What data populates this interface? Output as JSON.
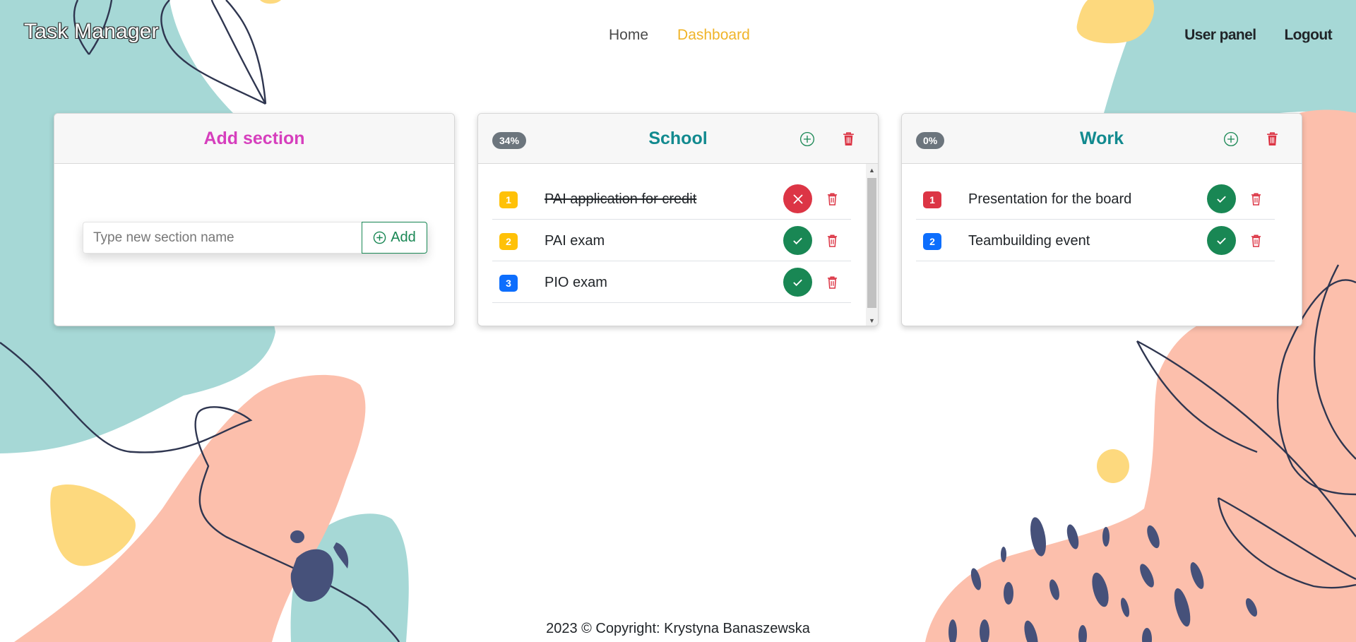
{
  "app": {
    "brand": "Task Manager"
  },
  "nav": {
    "links": [
      {
        "label": "Home",
        "active": false
      },
      {
        "label": "Dashboard",
        "active": true
      }
    ],
    "right": [
      "User panel",
      "Logout"
    ]
  },
  "add_section": {
    "title": "Add section",
    "input_placeholder": "Type new section name",
    "input_value": "",
    "button_label": "Add"
  },
  "sections": [
    {
      "title": "School",
      "progress": "34%",
      "tasks": [
        {
          "num": "1",
          "text": "PAI application for credit",
          "done": true,
          "badge_color": "#ffc107",
          "status": "undo",
          "status_icon": "x-icon"
        },
        {
          "num": "2",
          "text": "PAI exam",
          "done": false,
          "badge_color": "#ffc107",
          "status": "complete",
          "status_icon": "check-icon"
        },
        {
          "num": "3",
          "text": "PIO exam",
          "done": false,
          "badge_color": "#0d6efd",
          "status": "complete",
          "status_icon": "check-icon"
        }
      ]
    },
    {
      "title": "Work",
      "progress": "0%",
      "tasks": [
        {
          "num": "1",
          "text": "Presentation for the board",
          "done": false,
          "badge_color": "#dc3545",
          "status": "complete",
          "status_icon": "check-icon"
        },
        {
          "num": "2",
          "text": "Teambuilding event",
          "done": false,
          "badge_color": "#0d6efd",
          "status": "complete",
          "status_icon": "check-icon"
        }
      ]
    }
  ],
  "footer": {
    "text": "2023 © Copyright: Krystyna Banaszewska"
  },
  "colors": {
    "accent": "#f0b429",
    "title_teal": "#128a8f",
    "title_pink": "#d63fbd",
    "success": "#198754",
    "danger": "#dc3545",
    "teal_blob": "#a6d8d6",
    "salmon_blob": "#fcbfac",
    "yellow_blob": "#fdd97e",
    "navy": "#2f3650"
  }
}
